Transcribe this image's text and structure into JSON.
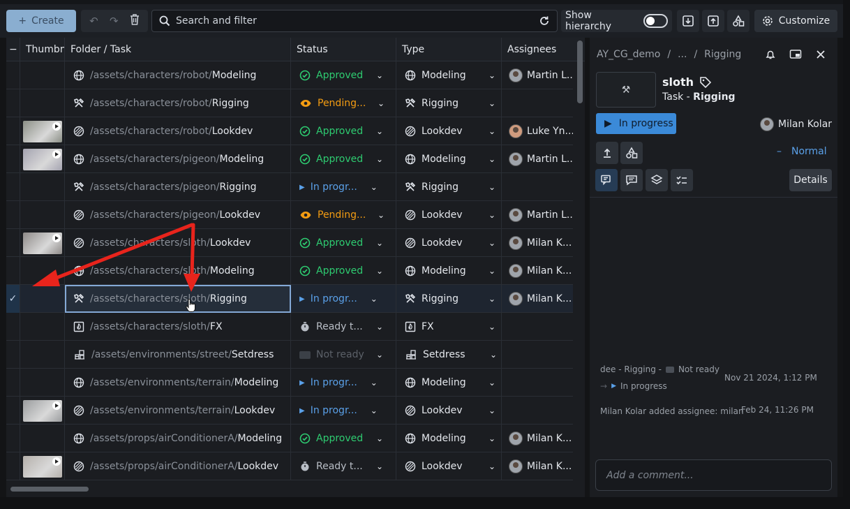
{
  "toolbar": {
    "create_label": "Create",
    "search_placeholder": "Search and filter",
    "hierarchy_label": "Show hierarchy",
    "customize_label": "Customize"
  },
  "columns": {
    "thumbnail": "Thumbn",
    "folder_task": "Folder / Task",
    "status": "Status",
    "type": "Type",
    "assignees": "Assignees"
  },
  "rows": [
    {
      "path": "/assets/characters/robot/",
      "name": "Modeling",
      "icon": "globe-icon",
      "thumb": false,
      "status": "Approved",
      "status_kind": "approved",
      "type": "Modeling",
      "assignee": "Martin L...",
      "avatar": "martin",
      "selected": false
    },
    {
      "path": "/assets/characters/robot/",
      "name": "Rigging",
      "icon": "tools-icon",
      "thumb": false,
      "status": "Pending...",
      "status_kind": "pending",
      "type": "Rigging",
      "assignee": "",
      "avatar": "",
      "selected": false
    },
    {
      "path": "/assets/characters/robot/",
      "name": "Lookdev",
      "icon": "lookdev-icon",
      "thumb": true,
      "thumb_color": "#8b8f86",
      "status": "Approved",
      "status_kind": "approved",
      "type": "Lookdev",
      "assignee": "Luke Yn...",
      "avatar": "luke",
      "selected": false
    },
    {
      "path": "/assets/characters/pigeon/",
      "name": "Modeling",
      "icon": "globe-icon",
      "thumb": true,
      "thumb_color": "#a4a3b0",
      "status": "Approved",
      "status_kind": "approved",
      "type": "Modeling",
      "assignee": "Martin L...",
      "avatar": "martin",
      "selected": false
    },
    {
      "path": "/assets/characters/pigeon/",
      "name": "Rigging",
      "icon": "tools-icon",
      "thumb": false,
      "status": "In progr...",
      "status_kind": "progress",
      "type": "Rigging",
      "assignee": "",
      "avatar": "",
      "selected": false
    },
    {
      "path": "/assets/characters/pigeon/",
      "name": "Lookdev",
      "icon": "lookdev-icon",
      "thumb": false,
      "status": "Pending...",
      "status_kind": "pending",
      "type": "Lookdev",
      "assignee": "Martin L...",
      "avatar": "martin",
      "selected": false
    },
    {
      "path": "/assets/characters/sloth/",
      "name": "Lookdev",
      "icon": "lookdev-icon",
      "thumb": true,
      "thumb_color": "#8e8a88",
      "status": "Approved",
      "status_kind": "approved",
      "type": "Lookdev",
      "assignee": "Milan K...",
      "avatar": "milan",
      "selected": false
    },
    {
      "path": "/assets/characters/sloth/",
      "name": "Modeling",
      "icon": "globe-icon",
      "thumb": false,
      "status": "Approved",
      "status_kind": "approved",
      "type": "Modeling",
      "assignee": "Milan K...",
      "avatar": "milan",
      "selected": false
    },
    {
      "path": "/assets/characters/sloth/",
      "name": "Rigging",
      "icon": "tools-icon",
      "thumb": false,
      "status": "In progr...",
      "status_kind": "progress",
      "type": "Rigging",
      "assignee": "Milan K...",
      "avatar": "milan",
      "selected": true
    },
    {
      "path": "/assets/characters/sloth/",
      "name": "FX",
      "icon": "fx-icon",
      "thumb": false,
      "status": "Ready t...",
      "status_kind": "ready",
      "type": "FX",
      "assignee": "",
      "avatar": "",
      "selected": false
    },
    {
      "path": "/assets/environments/street/",
      "name": "Setdress",
      "icon": "setdress-icon",
      "thumb": false,
      "status": "Not ready",
      "status_kind": "notready",
      "type": "Setdress",
      "assignee": "",
      "avatar": "",
      "selected": false
    },
    {
      "path": "/assets/environments/terrain/",
      "name": "Modeling",
      "icon": "globe-icon",
      "thumb": false,
      "status": "In progr...",
      "status_kind": "progress",
      "type": "Modeling",
      "assignee": "",
      "avatar": "",
      "selected": false
    },
    {
      "path": "/assets/environments/terrain/",
      "name": "Lookdev",
      "icon": "lookdev-icon",
      "thumb": true,
      "thumb_color": "#9a9c9e",
      "status": "In progr...",
      "status_kind": "progress",
      "type": "Lookdev",
      "assignee": "",
      "avatar": "",
      "selected": false
    },
    {
      "path": "/assets/props/airConditionerA/",
      "name": "Modeling",
      "icon": "globe-icon",
      "thumb": false,
      "status": "Approved",
      "status_kind": "approved",
      "type": "Modeling",
      "assignee": "Milan K...",
      "avatar": "milan",
      "selected": false
    },
    {
      "path": "/assets/props/airConditionerA/",
      "name": "Lookdev",
      "icon": "lookdev-icon",
      "thumb": true,
      "thumb_color": "#b5b0ab",
      "status": "Ready t...",
      "status_kind": "ready",
      "type": "Lookdev",
      "assignee": "Milan K...",
      "avatar": "milan",
      "selected": false
    }
  ],
  "panel": {
    "breadcrumb_project": "AY_CG_demo",
    "breadcrumb_sep": "/",
    "breadcrumb_ellipsis": "...",
    "breadcrumb_task": "Rigging",
    "task_name": "sloth",
    "task_sub_prefix": "Task -",
    "task_sub_type": "Rigging",
    "status_label": "In progress",
    "assignee_name": "Milan Kolar",
    "priority_label": "Normal",
    "details_label": "Details",
    "activity": [
      {
        "line1_prefix": "dee - Rigging -",
        "line1_status": "Not ready",
        "line2_status": "In progress",
        "date": "Nov 21 2024, 1:12 PM"
      },
      {
        "text": "Milan Kolar added assignee: milan",
        "date": "Feb 24, 11:26 PM"
      }
    ],
    "comment_placeholder": "Add a comment..."
  },
  "colors": {
    "accent": "#3b8ad8",
    "approved": "#2ecc71",
    "pending": "#f39c12",
    "in_progress": "#5aa0e8",
    "annotation_arrow": "#e8241c"
  }
}
